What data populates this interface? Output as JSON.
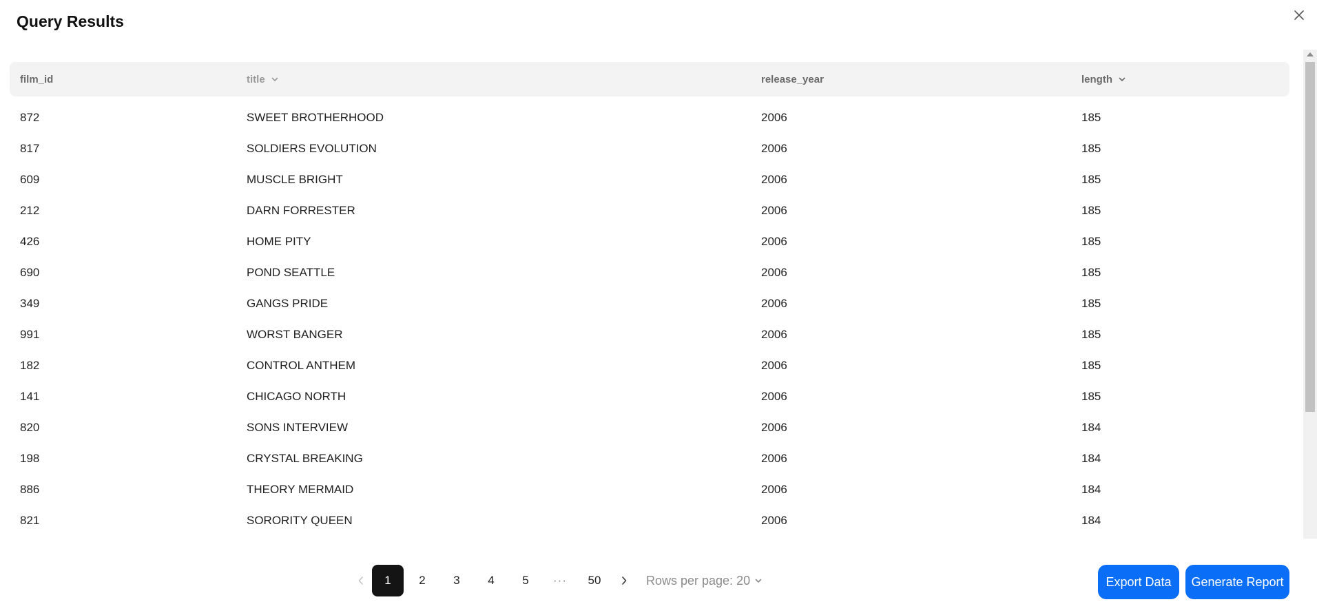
{
  "modal": {
    "title": "Query Results"
  },
  "table": {
    "columns": [
      {
        "label": "film_id",
        "sortable": false
      },
      {
        "label": "title",
        "sortable": true
      },
      {
        "label": "release_year",
        "sortable": false
      },
      {
        "label": "length",
        "sortable": true
      }
    ],
    "rows": [
      [
        "872",
        "SWEET BROTHERHOOD",
        "2006",
        "185"
      ],
      [
        "817",
        "SOLDIERS EVOLUTION",
        "2006",
        "185"
      ],
      [
        "609",
        "MUSCLE BRIGHT",
        "2006",
        "185"
      ],
      [
        "212",
        "DARN FORRESTER",
        "2006",
        "185"
      ],
      [
        "426",
        "HOME PITY",
        "2006",
        "185"
      ],
      [
        "690",
        "POND SEATTLE",
        "2006",
        "185"
      ],
      [
        "349",
        "GANGS PRIDE",
        "2006",
        "185"
      ],
      [
        "991",
        "WORST BANGER",
        "2006",
        "185"
      ],
      [
        "182",
        "CONTROL ANTHEM",
        "2006",
        "185"
      ],
      [
        "141",
        "CHICAGO NORTH",
        "2006",
        "185"
      ],
      [
        "820",
        "SONS INTERVIEW",
        "2006",
        "184"
      ],
      [
        "198",
        "CRYSTAL BREAKING",
        "2006",
        "184"
      ],
      [
        "886",
        "THEORY MERMAID",
        "2006",
        "184"
      ],
      [
        "821",
        "SORORITY QUEEN",
        "2006",
        "184"
      ]
    ]
  },
  "pagination": {
    "pages": [
      "1",
      "2",
      "3",
      "4",
      "5",
      "···",
      "50"
    ],
    "current": "1",
    "rows_per_page_label": "Rows per page: 20"
  },
  "actions": {
    "export_label": "Export Data",
    "report_label": "Generate Report"
  },
  "colors": {
    "primary": "#0b6ef6",
    "active_page": "#141414",
    "header_bg": "#f3f3f3"
  },
  "icons": {
    "close": "close-icon",
    "sort": "chevron-down-icon",
    "prev": "chevron-left-icon",
    "next": "chevron-right-icon"
  }
}
